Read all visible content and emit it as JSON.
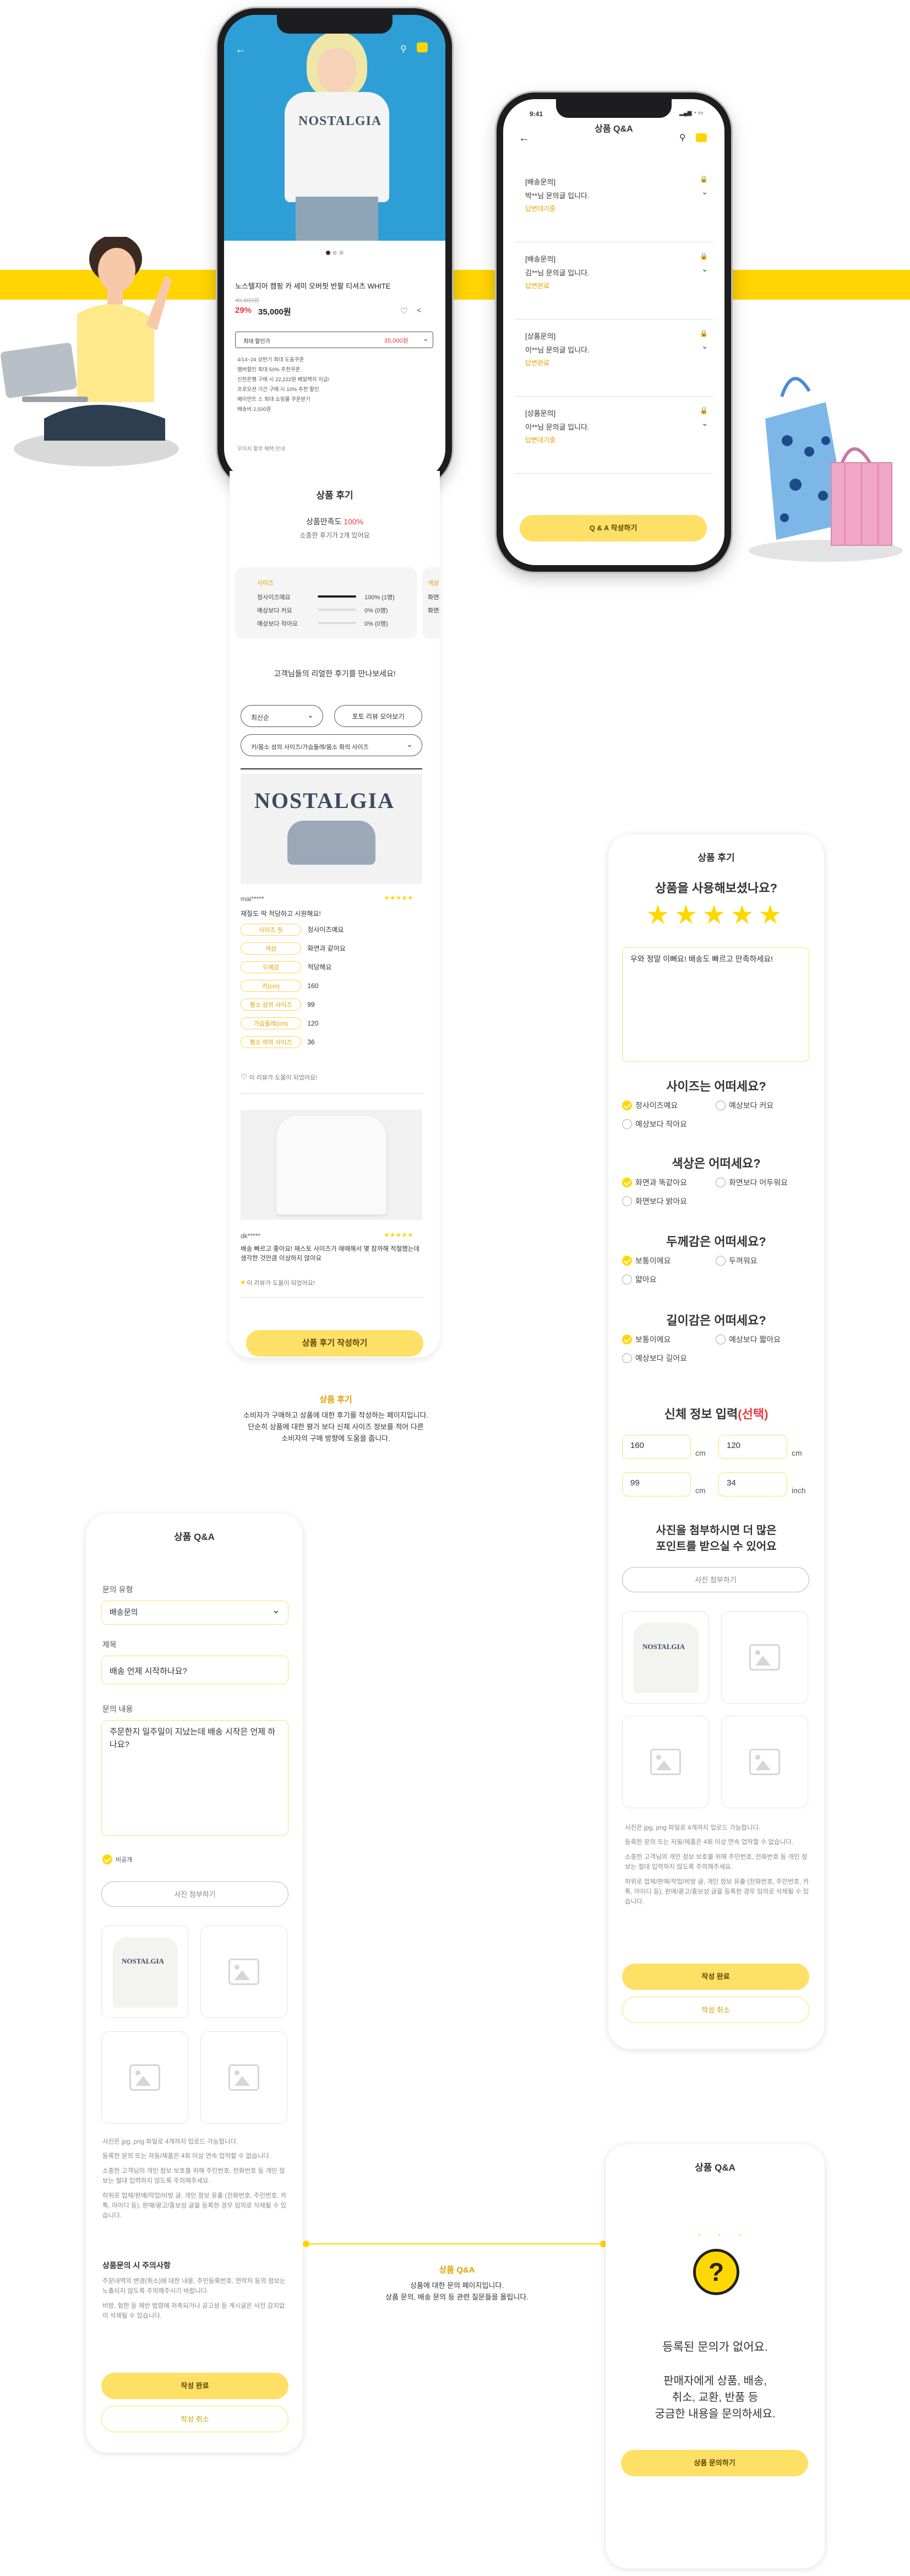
{
  "product": {
    "name": "노스텔지아 캠핑 카 세미 오버핏 반팔 티셔츠 WHITE",
    "orig_price": "49,800원",
    "discount": "29%",
    "price": "35,000원",
    "coupon_label": "최대 할인가",
    "coupon_price": "35,000원",
    "benefits": [
      "4/14~24 상반기 최대 도움쿠폰",
      "멤버할인 최대 50% 추천쿠폰",
      "신한은행 구매 시 22,222원 페일백지 지급!",
      "프로모션 기간 구매 시 10% 추천 할인",
      "페이먼트 스 최대 쇼핑몰 쿠폰받기",
      "배송비 2,500원"
    ],
    "more": "무이자 할부 혜택 안내"
  },
  "review_section": {
    "title": "상품 후기",
    "satisfaction_label": "상품만족도",
    "satisfaction_value": "100%",
    "count_text": "소중한 후기가 2개 있어요",
    "size_box": {
      "title": "사이즈",
      "rows": [
        {
          "label": "정사이즈예요",
          "value": "100% (1명)"
        },
        {
          "label": "예상보다 커요",
          "value": "0% (0명)"
        },
        {
          "label": "예상보다 작아요",
          "value": "0% (0명)"
        }
      ]
    },
    "color_box_title": "색상",
    "color_box_rows": [
      "화면과",
      "화면보"
    ],
    "headline": "고객님들의 리얼한 후기를 만나보세요!",
    "sort_label": "최신순",
    "photo_only": "포토 리뷰 모아보기",
    "filter_label": "키/몸소 성의 사이즈/가슴둘레/몸소 화의 사이즈",
    "review1": {
      "user": "mai*****",
      "stars": "★★★★★",
      "text": "재질도 딱 적당하고 시원해요!",
      "rows": [
        {
          "tag": "사이즈 핏",
          "value": "정사이즈예요"
        },
        {
          "tag": "색상",
          "value": "화면과 같아요"
        },
        {
          "tag": "두께감",
          "value": "적당해요"
        },
        {
          "tag": "키(cm)",
          "value": "160"
        },
        {
          "tag": "평소 상의 사이즈",
          "value": "99"
        },
        {
          "tag": "가슴둘레(cm)",
          "value": "120"
        },
        {
          "tag": "평소 하의 사이즈",
          "value": "36"
        }
      ],
      "helpful": "이 리뷰가 도움이 되었어요!"
    },
    "review2": {
      "user": "dk*****",
      "stars": "★★★★★",
      "text": "배송 빠르고 좋아요! 재스토 사이즈가 애매해서 몇 참까해 적절했는데 생각한 것만큼 이상하지 않아요",
      "helpful": "이 리뷰가 도움이 되었어요!"
    },
    "write_button": "상품 후기 작성하기"
  },
  "caption1": {
    "title": "상품 후기",
    "body": "소비자가 구매하고 상품에 대한 후기를 작성하는 페이지입니다.\n단순히 상품에 대한 평가 보다 신체 사이즈 정보를 적어 다른\n소비자의 구매 방향에 도움을 줍니다."
  },
  "qa_list": {
    "time": "9:41",
    "title": "상품 Q&A",
    "items": [
      {
        "type": "[배송문의]",
        "user": "박**님 문의글 입니다.",
        "status": "답변대기중"
      },
      {
        "type": "[배송문의]",
        "user": "김**님 문의글 입니다.",
        "status": "답변완료"
      },
      {
        "type": "[상품문의]",
        "user": "이**님 문의글 입니다.",
        "status": "답변완료"
      },
      {
        "type": "[상품문의]",
        "user": "이**님 문의글 입니다.",
        "status": "답변대기중"
      }
    ],
    "button": "Q & A 작성하기"
  },
  "review_form": {
    "title": "상품 후기",
    "q_use": "상품을 사용해보셨나요?",
    "stars": "★★★★★",
    "text": "우와 정말 이뻐요! 배송도 빠르고 만족하세요!",
    "q_size": "사이즈는 어떠세요?",
    "size_opts": [
      "정사이즈예요",
      "예상보다 커요",
      "예상보다 작아요"
    ],
    "q_color": "색상은 어떠세요?",
    "color_opts": [
      "화면과 똑같아요",
      "화면보다 어두워요",
      "화면보다 밝아요"
    ],
    "q_thick": "두께감은 어떠세요?",
    "thick_opts": [
      "보통이에요",
      "두꺼워요",
      "얇아요"
    ],
    "q_length": "길이감은 어떠세요?",
    "length_opts": [
      "보통이에요",
      "예상보다 짧아요",
      "예상보다 길어요"
    ],
    "q_body": "신체 정보 입력",
    "q_body_opt": "(선택)",
    "body_vals": [
      {
        "value": "160",
        "unit": "cm"
      },
      {
        "value": "120",
        "unit": "cm"
      },
      {
        "value": "99",
        "unit": "cm"
      },
      {
        "value": "34",
        "unit": "inch"
      }
    ],
    "q_photo": "사진을 첨부하시면 더 많은\n포인트를 받으실 수 있어요",
    "photo_button": "사진 첨부하기",
    "notes": [
      "사진은 jpg, png 파일로 4개까지 업로드 가능합니다.",
      "등록한 문의 또는 자동/제품은 4회 이상 연속 업작할 수 없습니다.",
      "소중한 고객님의 개인 정보 보호를 위해 주민번호, 전화번호 등 개인 정보는 절대 입력하지 않도록 주의해주세요.",
      "허위로 업체/판매/작업/비방 글, 개인 정보 유출 (전화번호, 주민번호, 카톡, 아이디 등), 판매/광고/홍보성 글을 등록한 경우 임의로 삭제될 수 있습니다."
    ],
    "submit": "작성 완료",
    "cancel": "작성 취소"
  },
  "qa_form": {
    "title": "상품 Q&A",
    "type_label": "문의 유형",
    "type_value": "배송문의",
    "subject_label": "제목",
    "subject_value": "배송 언제 시작하나요?",
    "content_label": "문의 내용",
    "content_value": "주문한지 일주일이 지났는데 배송 시작은 언제 하나요?",
    "secret": "비공개",
    "photo_button": "사진 첨부하기",
    "notes": [
      "사진은 jpg, png 파일로 4개까지 업로드 가능합니다.",
      "등록한 문의 또는 자동/제품은 4회 이상 연속 업작할 수 없습니다.",
      "소중한 고객님의 개인 정보 보호를 위해 주민번호, 전화번호 등 개인 정보는 절대 입력하지 않도록 주의해주세요.",
      "허위로 업체/판매/작업/비방 글, 개인 정보 유출 (전화번호, 주민번호, 카톡, 아이디 등), 판매/광고/홍보성 글을 등록한 경우 임의로 삭제될 수 있습니다."
    ],
    "caution_title": "상품문의 시 주의사항",
    "caution_notes": [
      "주문내역의 변경(취소)에 대한 내용, 주민등록번호, 연락처 등의 정보는 노출되지 않도록 주의해주시기 바랍니다.",
      "비방, 험한 등 제반 법령에 저촉되거나 공고성 등 게시글은 사전 감지없이 삭제될 수 있습니다."
    ],
    "submit": "작성 완료",
    "cancel": "작성 취소"
  },
  "caption2": {
    "title": "상품 Q&A",
    "body": "상품에 대한 문의 페이지입니다.\n상품 문의, 배송 문의 등 관련 질문들을 올립니다."
  },
  "qa_empty": {
    "title": "상품 Q&A",
    "text1": "등록된 문의가 없어요.",
    "text2": "판매자에게 상품, 배송,\n취소, 교환, 반품 등\n궁금한 내용을 문의하세요.",
    "button": "상품 문의하기"
  },
  "colors": {
    "accent": "#ffd800",
    "button": "#ffe067",
    "red": "#e8383d"
  }
}
